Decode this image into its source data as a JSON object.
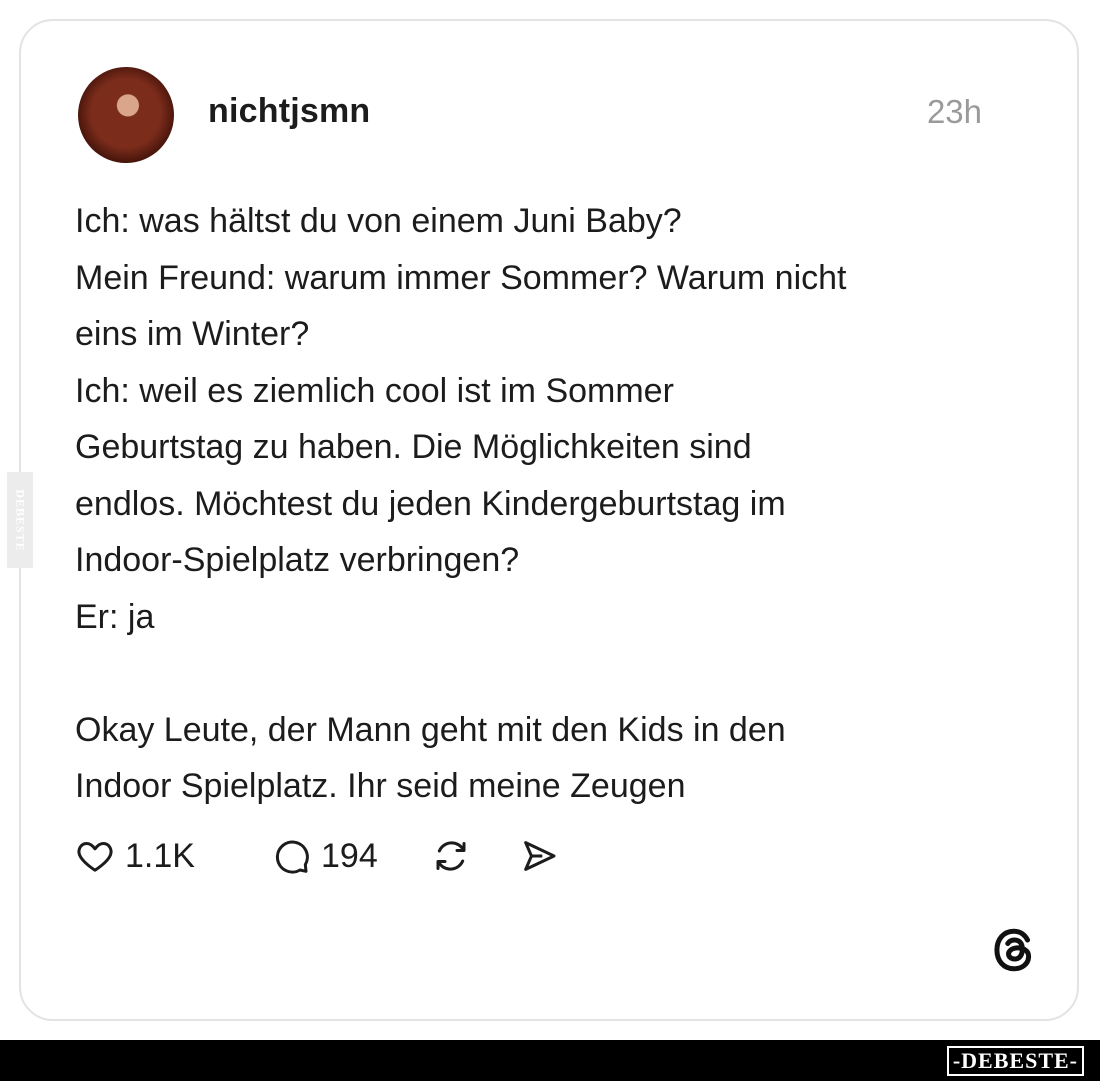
{
  "post": {
    "username": "nichtjsmn",
    "time": "23h",
    "text": "Ich: was hältst du von einem Juni Baby?\nMein Freund: warum immer Sommer? Warum nicht\neins im Winter?\nIch: weil es ziemlich cool ist im Sommer\nGeburtstag zu haben. Die Möglichkeiten sind\nendlos. Möchtest du jeden Kindergeburtstag im\nIndoor-Spielplatz verbringen?\nEr: ja\n\nOkay Leute, der Mann geht mit den Kids in den\nIndoor Spielplatz. Ihr seid meine Zeugen",
    "likes": "1.1K",
    "comments": "194"
  },
  "icons": {
    "like": "heart-icon",
    "comment": "comment-bubble-icon",
    "repost": "repost-icon",
    "share": "send-icon",
    "platform": "threads-logo-icon"
  },
  "watermark": {
    "side": "DEBESTE",
    "bottom": "-DEBESTE-"
  },
  "colors": {
    "text": "#1c1c1c",
    "muted": "#9a9a9a",
    "border": "#e3e3e3",
    "bar": "#000000"
  }
}
